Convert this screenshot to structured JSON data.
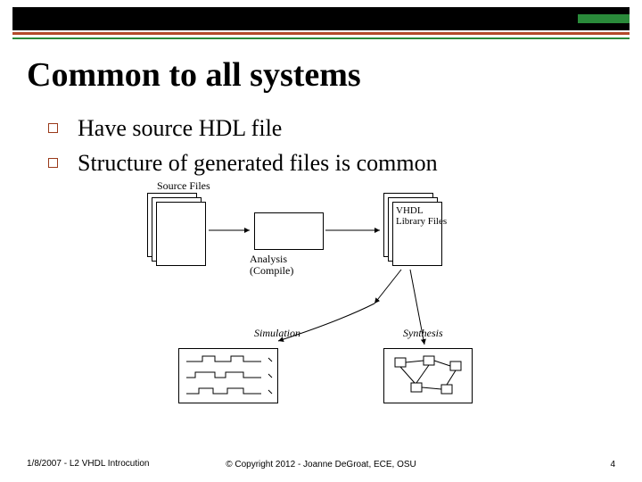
{
  "title": "Common to all systems",
  "bullets": [
    "Have source HDL file",
    "Structure of generated files is common"
  ],
  "diagram": {
    "source_label": "Source Files",
    "analysis_label": "Analysis\n(Compile)",
    "vhdllib_label": "VHDL\nLibrary Files",
    "simulation_label": "Simulation",
    "synthesis_label": "Synthesis"
  },
  "footer": {
    "left": "1/8/2007 - L2 VHDL Introcution",
    "center": "© Copyright 2012 - Joanne DeGroat, ECE, OSU",
    "page": "4"
  }
}
